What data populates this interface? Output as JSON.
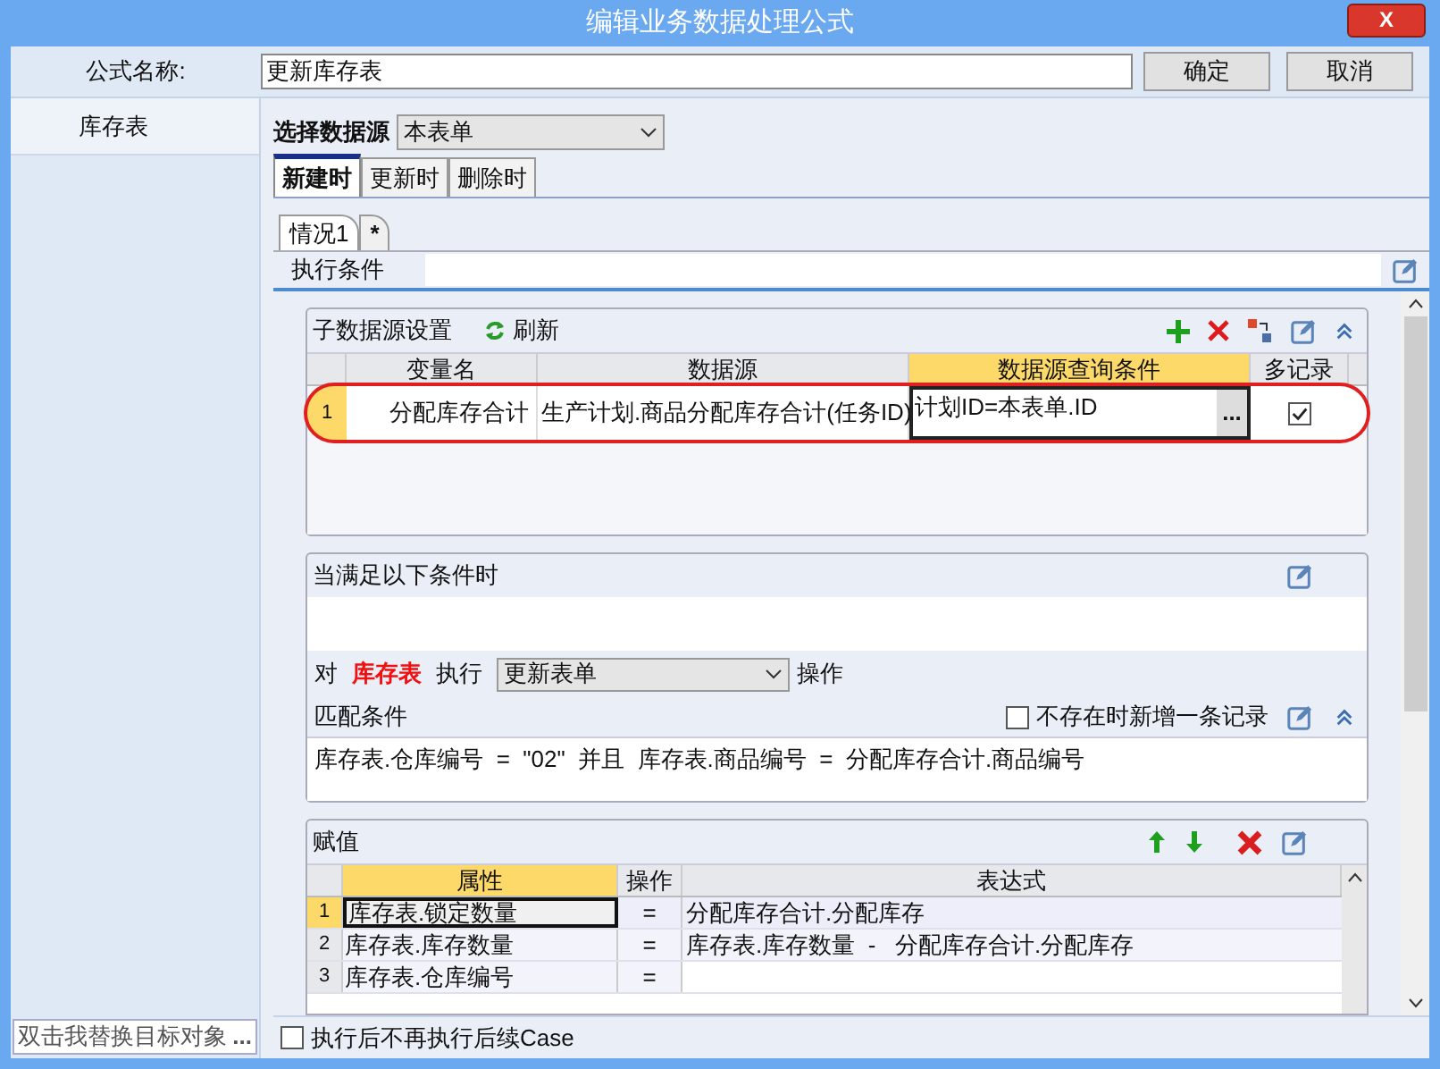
{
  "window": {
    "title": "编辑业务数据处理公式",
    "close_label": "X"
  },
  "formula_name": {
    "label": "公式名称:",
    "value": "更新库存表"
  },
  "buttons": [
    "确定",
    "取消"
  ],
  "sidebar": {
    "items": [
      {
        "label": "库存表",
        "selected": true
      }
    ],
    "footer": {
      "value": "双击我替换目标对象",
      "button": "..."
    }
  },
  "data_source": {
    "label": "选择数据源",
    "value": "本表单"
  },
  "event_tabs": [
    {
      "label": "新建时",
      "selected": true
    },
    {
      "label": "更新时",
      "selected": false
    },
    {
      "label": "删除时",
      "selected": false
    }
  ],
  "case_tabs": [
    {
      "label": "情况1",
      "selected": true
    },
    {
      "label": "*",
      "selected": false
    }
  ],
  "exec_condition": {
    "label": "执行条件"
  },
  "sub_source": {
    "title": "子数据源设置",
    "refresh": "刷新",
    "columns": [
      {
        "label": "变量名",
        "selected": false
      },
      {
        "label": "数据源",
        "selected": false
      },
      {
        "label": "数据源查询条件",
        "selected": true
      },
      {
        "label": "多记录",
        "selected": false
      }
    ],
    "rows": [
      {
        "index": "1",
        "variable": "分配库存合计",
        "source": "生产计划.商品分配库存合计(任务ID)",
        "condition": "计划ID=本表单.ID",
        "condition_button": "...",
        "multi": true,
        "highlighted": true
      }
    ]
  },
  "when": {
    "title": "当满足以下条件时",
    "target_prefix": "对",
    "target": "库存表",
    "exec_label": "执行",
    "action": "更新表单",
    "suffix": "操作",
    "match_label": "匹配条件",
    "add_if_missing": {
      "label": "不存在时新增一条记录",
      "checked": false
    },
    "match_expr": "库存表.仓库编号  =  \"02\"  并且  库存表.商品编号  =  分配库存合计.商品编号"
  },
  "assign": {
    "title": "赋值",
    "columns": [
      {
        "label": "属性",
        "selected": true
      },
      {
        "label": "操作",
        "selected": false
      },
      {
        "label": "表达式",
        "selected": false
      }
    ],
    "rows": [
      {
        "index": "1",
        "property": "库存表.锁定数量",
        "op": "=",
        "expr": "分配库存合计.分配库存",
        "selected": true
      },
      {
        "index": "2",
        "property": "库存表.库存数量",
        "op": "=",
        "expr": "库存表.库存数量  -   分配库存合计.分配库存",
        "selected": false
      },
      {
        "index": "3",
        "property": "库存表.仓库编号",
        "op": "=",
        "selected": false
      }
    ]
  },
  "footer_checkbox": {
    "label": "执行后不再执行后续Case",
    "checked": false
  }
}
